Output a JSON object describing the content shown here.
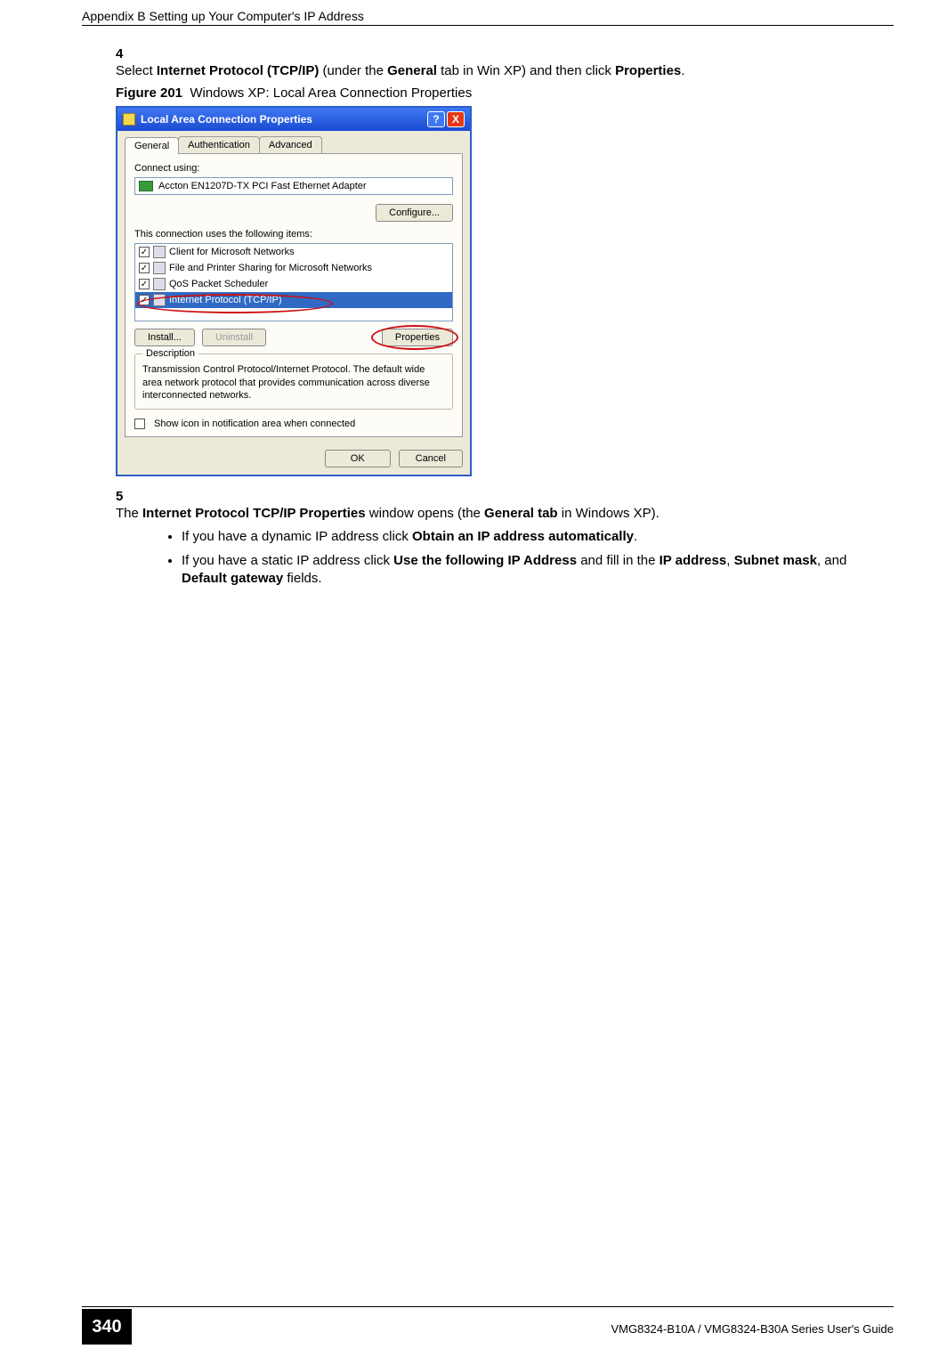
{
  "header": {
    "running": "Appendix B Setting up Your Computer's IP Address"
  },
  "figure": {
    "label": "Figure 201",
    "title": "Windows XP: Local Area Connection Properties"
  },
  "steps": [
    {
      "num": "4",
      "pre": "Select ",
      "b1": "Internet Protocol (TCP/IP)",
      "mid1": " (under the ",
      "b2": "General",
      "mid2": " tab in Win XP) and then click ",
      "b3": "Properties",
      "post": "."
    },
    {
      "num": "5",
      "pre": "The ",
      "b1": "Internet Protocol TCP/IP Properties",
      "mid1": " window opens (the ",
      "b2": "General tab",
      "post": " in Windows XP)."
    }
  ],
  "bullets": [
    {
      "pre": "If you have a dynamic IP address click ",
      "b1": "Obtain an IP address automatically",
      "post": "."
    },
    {
      "pre": "If you have a static IP address click ",
      "b1": "Use the following IP Address",
      "mid1": " and fill in the ",
      "b2": "IP address",
      "mid2": ", ",
      "b3": "Subnet mask",
      "mid3": ", and ",
      "b4": "Default gateway",
      "post": " fields."
    }
  ],
  "dialog": {
    "title": "Local Area Connection Properties",
    "helpGlyph": "?",
    "closeGlyph": "X",
    "tabs": [
      "General",
      "Authentication",
      "Advanced"
    ],
    "connectUsing": "Connect using:",
    "adapter": "Accton EN1207D-TX PCI Fast Ethernet Adapter",
    "configure": "Configure...",
    "itemsLabel": "This connection uses the following items:",
    "items": [
      "Client for Microsoft Networks",
      "File and Printer Sharing for Microsoft Networks",
      "QoS Packet Scheduler",
      "Internet Protocol (TCP/IP)"
    ],
    "install": "Install...",
    "uninstall": "Uninstall",
    "properties": "Properties",
    "descLegend": "Description",
    "descText": "Transmission Control Protocol/Internet Protocol. The default wide area network protocol that provides communication across diverse interconnected networks.",
    "showIcon": "Show icon in notification area when connected",
    "ok": "OK",
    "cancel": "Cancel"
  },
  "footer": {
    "page": "340",
    "guide": "VMG8324-B10A / VMG8324-B30A Series User's Guide"
  }
}
